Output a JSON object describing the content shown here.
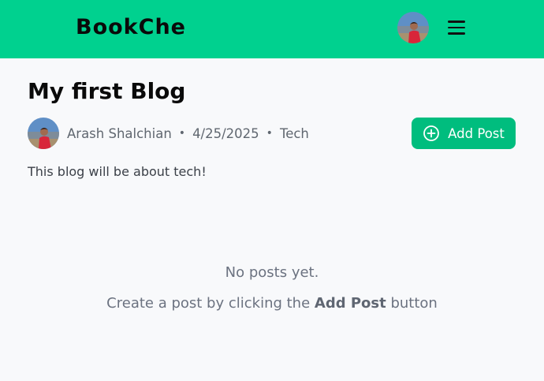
{
  "header": {
    "brand": "BookChe",
    "avatar_icon": "user-avatar",
    "menu_icon": "hamburger-menu-icon",
    "background_color": "#00d18f"
  },
  "blog": {
    "title": "My first Blog",
    "author": "Arash Shalchian",
    "date": "4/25/2025",
    "category": "Tech",
    "separator": "•",
    "description": "This blog will be about tech!"
  },
  "actions": {
    "add_post_label": "Add Post",
    "add_post_icon": "plus-circle-icon",
    "add_post_color": "#00bd7e"
  },
  "empty_state": {
    "title": "No posts yet.",
    "hint_before": "Create a post by clicking the ",
    "hint_bold": "Add Post",
    "hint_after": " button"
  }
}
